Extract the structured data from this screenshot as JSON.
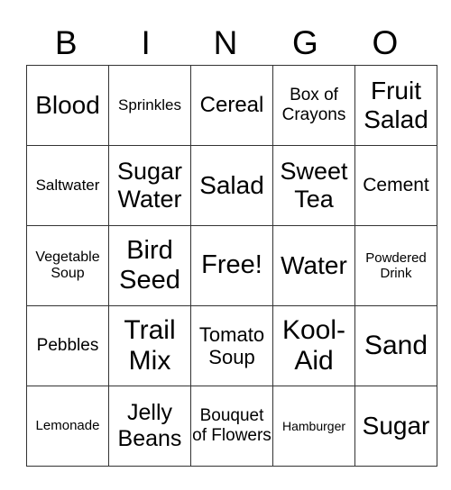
{
  "header": [
    "B",
    "I",
    "N",
    "G",
    "O"
  ],
  "rows": [
    [
      "Blood",
      "Sprinkles",
      "Cereal",
      "Box of Crayons",
      "Fruit Salad"
    ],
    [
      "Saltwater",
      "Sugar Water",
      "Salad",
      "Sweet Tea",
      "Cement"
    ],
    [
      "Vegetable Soup",
      "Bird Seed",
      "Free!",
      "Water",
      "Powdered Drink"
    ],
    [
      "Pebbles",
      "Trail Mix",
      "Tomato Soup",
      "Kool-Aid",
      "Sand"
    ],
    [
      "Lemonade",
      "Jelly Beans",
      "Bouquet of Flowers",
      "Hamburger",
      "Sugar"
    ]
  ]
}
